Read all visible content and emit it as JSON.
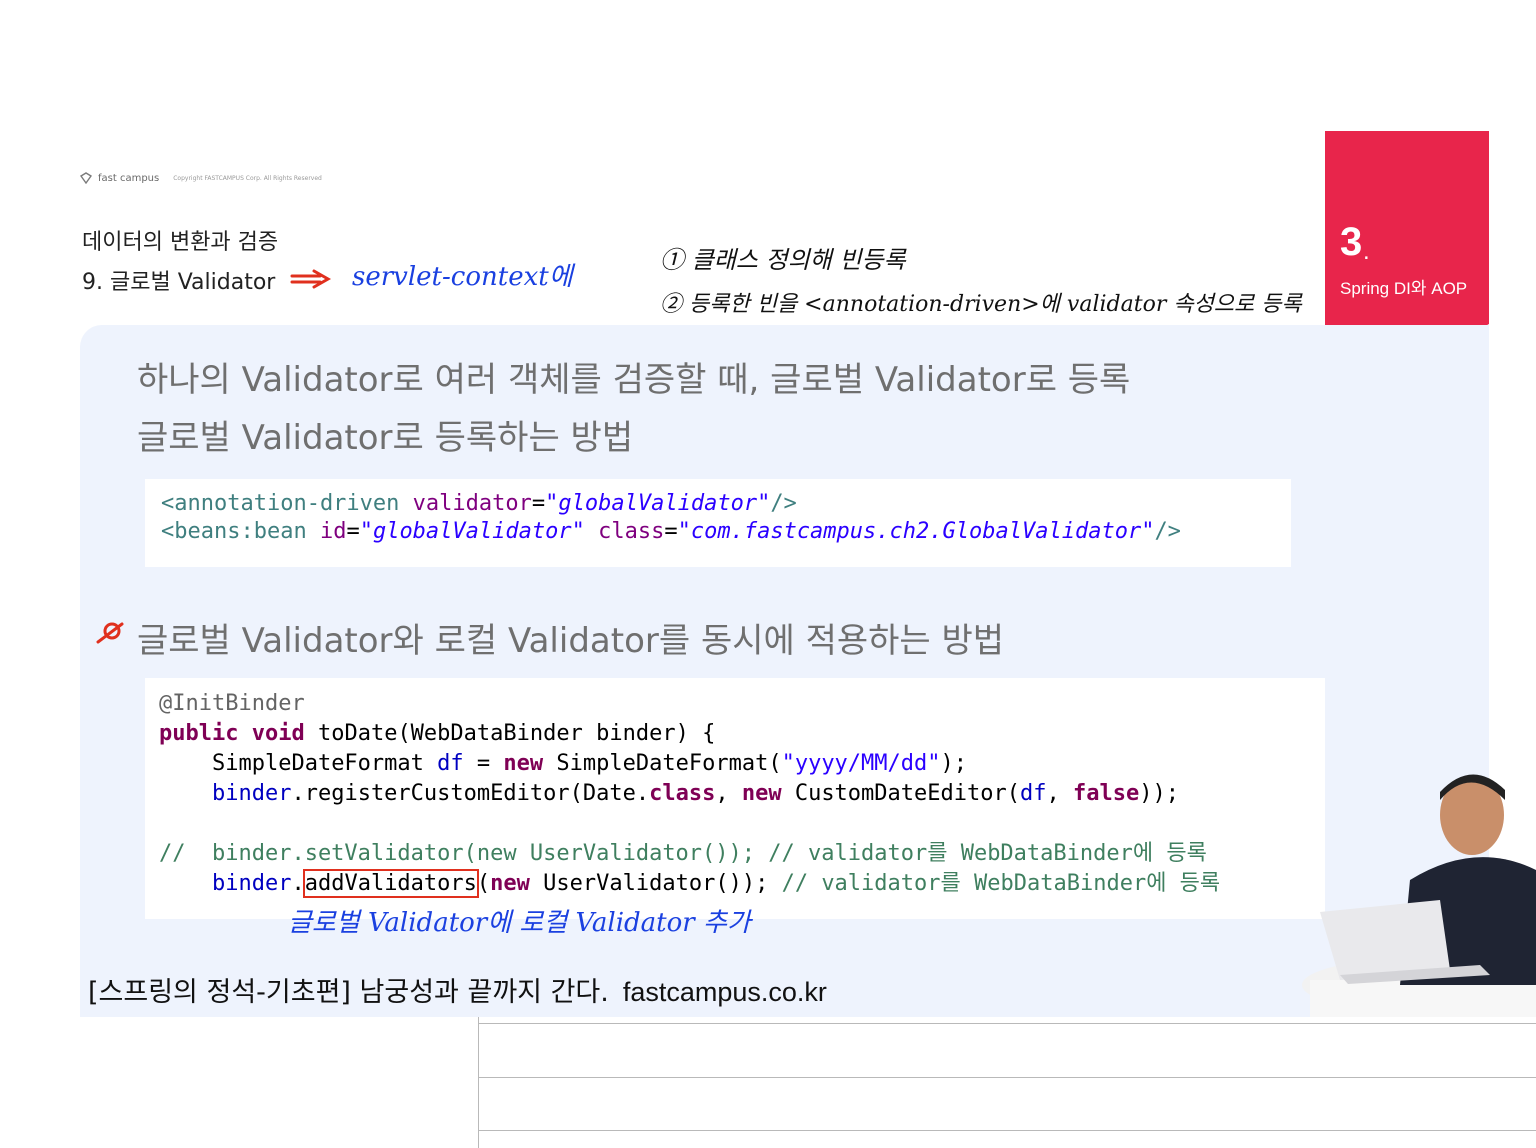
{
  "logo": {
    "text": "fast campus",
    "copyright": "Copyright FASTCAMPUS Corp. All Rights Reserved"
  },
  "header": {
    "title": "데이터의 변환과 검증",
    "subtitle": "9. 글로벌 Validator"
  },
  "chapter": {
    "number": "3",
    "dot": ".",
    "name": "Spring DI와 AOP",
    "color": "#e8254b"
  },
  "slide": {
    "line1": "하나의 Validator로 여러 객체를 검증할 때, 글로벌 Validator로 등록",
    "line2": "글로벌 Validator로 등록하는 방법",
    "line3": "글로벌 Validator와 로컬 Validator를 동시에 적용하는 방법"
  },
  "code1": {
    "l1": {
      "tag": "<annotation-driven",
      "attr": "validator",
      "eq": "=",
      "val": "\"globalValidator\"",
      "end": "/>"
    },
    "l2": {
      "tag": "<beans:bean",
      "attr1": "id",
      "eq1": "=",
      "val1": "\"globalValidator\"",
      "attr2": "class",
      "eq2": "=",
      "val2": "\"com.fastcampus.ch2.GlobalValidator\"",
      "end": "/>"
    }
  },
  "code2": {
    "l1": "@InitBinder",
    "l2": {
      "kw1": "public",
      "kw2": "void",
      "rest": "toDate(WebDataBinder binder) {"
    },
    "l3": {
      "a": "SimpleDateFormat ",
      "v": "df",
      "b": " = ",
      "kw": "new",
      "c": " SimpleDateFormat(",
      "s": "\"yyyy/MM/dd\"",
      "d": ");"
    },
    "l4": {
      "v1": "binder",
      "a": ".registerCustomEditor(Date.",
      "kw1": "class",
      "b": ", ",
      "kw2": "new",
      "c": " CustomDateEditor(",
      "v2": "df",
      "d": ", ",
      "kw3": "false",
      "e": "));"
    },
    "l5": "//  binder.setValidator(new UserValidator()); // validator를 WebDataBinder에 등록",
    "l6": {
      "v": "binder",
      "dot": ".",
      "boxed": "addValidators",
      "a": "(",
      "kw": "new",
      "b": " UserValidator()); ",
      "cm": "// validator를 WebDataBinder에 등록"
    }
  },
  "footer": {
    "text": "[스프링의 정석-기초편] 남궁성과 끝까지 간다.",
    "url": "fastcampus.co.kr"
  },
  "annotations": {
    "blue1": "servlet-context에",
    "black1": "① 클래스 정의해 빈등록",
    "black2": "② 등록한 빈을 <annotation-driven>에 validator 속성으로 등록",
    "blue2": "글로벌 Validator에 로컬 Validator 추가"
  }
}
